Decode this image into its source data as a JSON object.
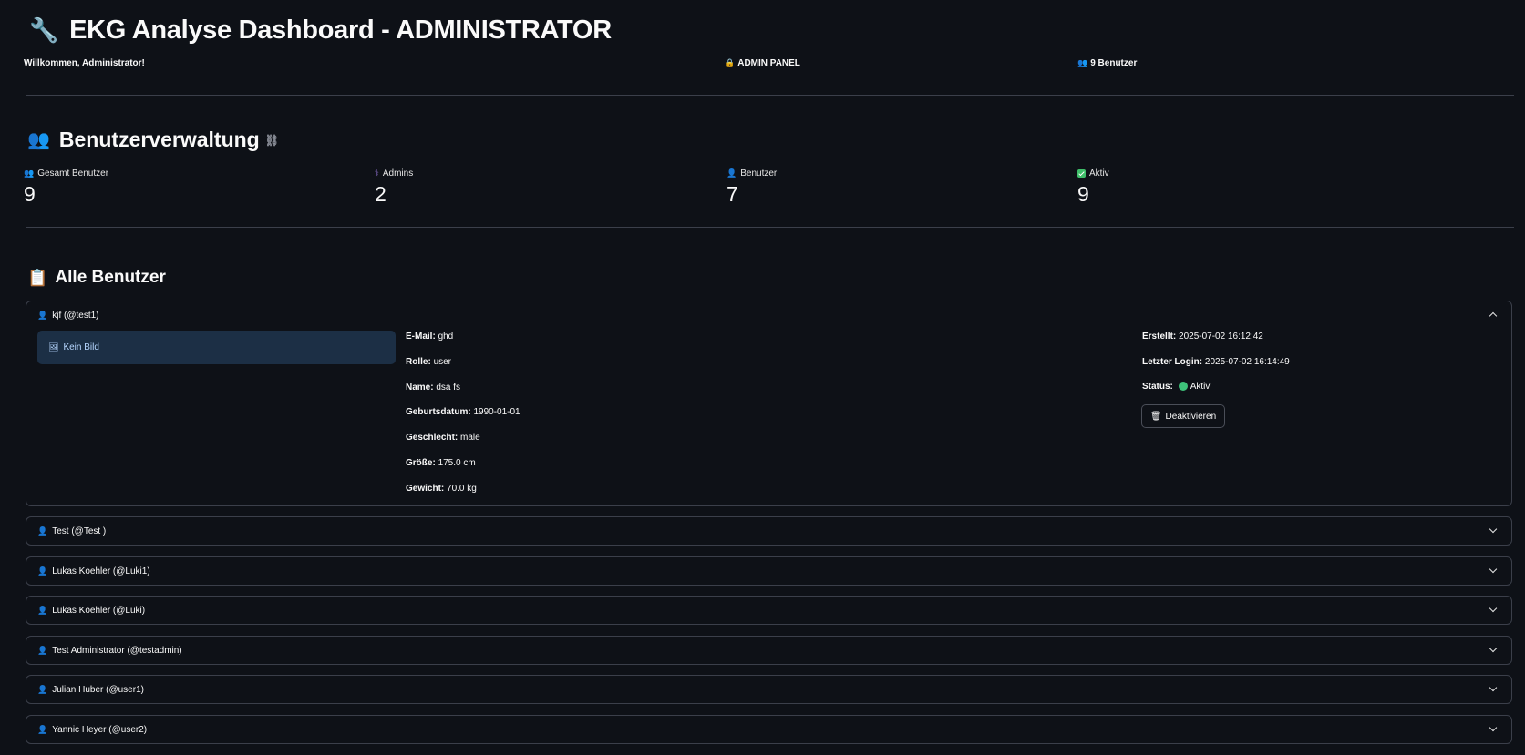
{
  "header": {
    "title_icon": "wrench-icon",
    "title": "EKG Analyse Dashboard - ADMINISTRATOR",
    "welcome": "Willkommen, Administrator!",
    "admin_panel": "ADMIN PANEL",
    "user_count": "9 Benutzer"
  },
  "management": {
    "heading": "Benutzerverwaltung",
    "metrics": [
      {
        "label": "Gesamt Benutzer",
        "value": "9",
        "icon": "users-icon"
      },
      {
        "label": "Admins",
        "value": "2",
        "icon": "stethoscope-icon"
      },
      {
        "label": "Benutzer",
        "value": "7",
        "icon": "user-icon"
      },
      {
        "label": "Aktiv",
        "value": "9",
        "icon": "check-icon"
      }
    ]
  },
  "all_users": {
    "heading": "Alle Benutzer",
    "expanded": {
      "title": "kjf (@test1)",
      "no_image": "Kein Bild",
      "fields": {
        "email_label": "E-Mail:",
        "email": "ghd",
        "role_label": "Rolle:",
        "role": "user",
        "name_label": "Name:",
        "name": "dsa fs",
        "birth_label": "Geburtsdatum:",
        "birth": "1990-01-01",
        "gender_label": "Geschlecht:",
        "gender": "male",
        "height_label": "Größe:",
        "height": "175.0 cm",
        "weight_label": "Gewicht:",
        "weight": "70.0 kg",
        "created_label": "Erstellt:",
        "created": "2025-07-02 16:12:42",
        "login_label": "Letzter Login:",
        "login": "2025-07-02 16:14:49",
        "status_label": "Status:",
        "status": "Aktiv"
      },
      "deactivate_label": "Deaktivieren"
    },
    "collapsed": [
      "Test (@Test )",
      "Lukas Koehler (@Luki1)",
      "Lukas Koehler (@Luki)",
      "Test Administrator (@testadmin)",
      "Julian Huber (@user1)",
      "Yannic Heyer (@user2)"
    ]
  }
}
